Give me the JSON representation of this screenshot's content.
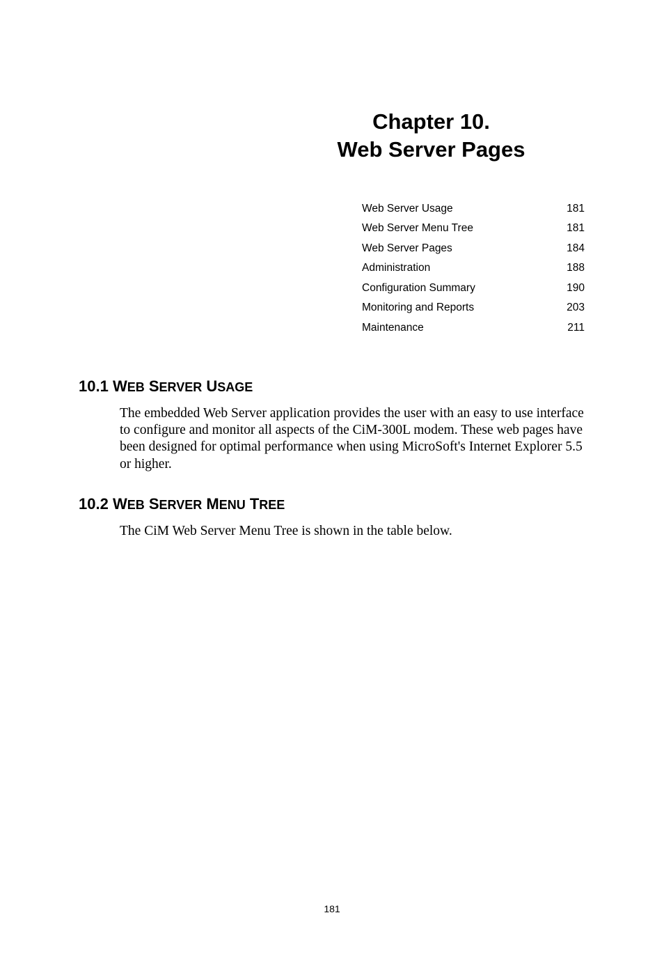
{
  "chapter": {
    "line1": "Chapter 10.",
    "line2": "Web Server Pages"
  },
  "toc": [
    {
      "label": "Web Server Usage",
      "page": "181"
    },
    {
      "label": "Web Server Menu Tree",
      "page": "181"
    },
    {
      "label": "Web Server Pages",
      "page": "184"
    },
    {
      "label": "Administration",
      "page": "188"
    },
    {
      "label": "Configuration Summary",
      "page": "190"
    },
    {
      "label": "Monitoring and Reports",
      "page": "203"
    },
    {
      "label": "Maintenance",
      "page": "211"
    }
  ],
  "sections": {
    "s1": {
      "num": "10.1 ",
      "w1_first": "W",
      "w1_rest": "EB",
      "w2_first": "S",
      "w2_rest": "ERVER",
      "w3_first": "U",
      "w3_rest": "SAGE",
      "body": "The embedded Web Server application provides the user with an easy to use interface to configure and monitor all aspects of the CiM-300L modem. These web pages have been designed for optimal performance when using MicroSoft's Internet Explorer 5.5 or higher."
    },
    "s2": {
      "num": "10.2 ",
      "w1_first": "W",
      "w1_rest": "EB",
      "w2_first": "S",
      "w2_rest": "ERVER",
      "w3_first": "M",
      "w3_rest": "ENU",
      "w4_first": "T",
      "w4_rest": "REE",
      "body": "The CiM Web Server Menu Tree is shown in the table below."
    }
  },
  "page_number": "181"
}
